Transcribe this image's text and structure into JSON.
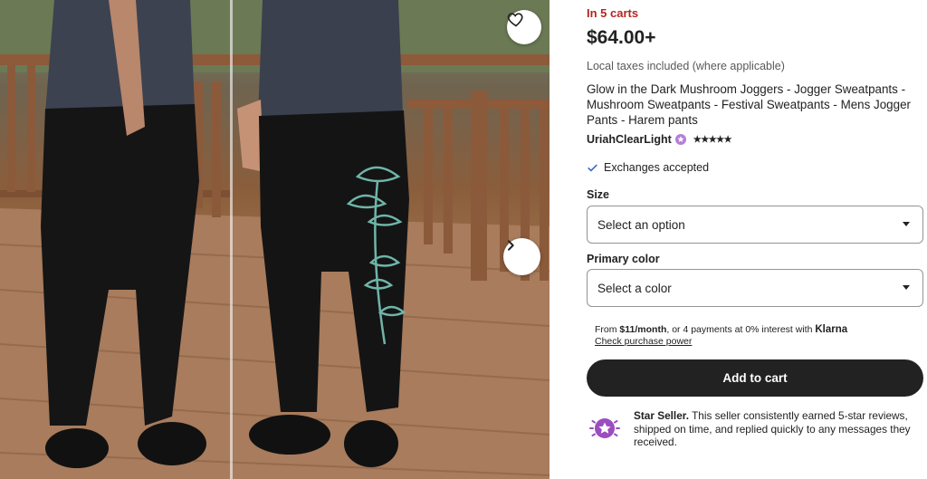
{
  "listing": {
    "in_carts": "In 5 carts",
    "price": "$64.00+",
    "taxes_note": "Local taxes included (where applicable)",
    "title": "Glow in the Dark Mushroom Joggers - Jogger Sweatpants - Mushroom Sweatpants - Festival Sweatpants - Mens Jogger Pants - Harem pants",
    "shop_name": "UriahClearLight",
    "rating_stars": "★★★★★",
    "exchanges": "Exchanges accepted"
  },
  "options": {
    "size_label": "Size",
    "size_placeholder": "Select an option",
    "color_label": "Primary color",
    "color_placeholder": "Select a color"
  },
  "klarna": {
    "prefix": "From ",
    "amount": "$11/month",
    "middle": ", or 4 payments at 0% interest with ",
    "brand": "Klarna",
    "link": "Check purchase power"
  },
  "cart": {
    "add_label": "Add to cart"
  },
  "star_seller": {
    "title": "Star Seller.",
    "body": " This seller consistently earned 5-star reviews, shipped on time, and replied quickly to any messages they received."
  },
  "colors": {
    "in_carts": "#b3261e",
    "button": "#222222",
    "check": "#3b67c9",
    "star_badge": "#9b4dbf"
  },
  "icons": {
    "favorite": "heart-icon",
    "next": "chevron-right-icon",
    "check": "check-icon",
    "dropdown": "caret-down-icon",
    "star_seller": "star-seller-badge-icon"
  }
}
